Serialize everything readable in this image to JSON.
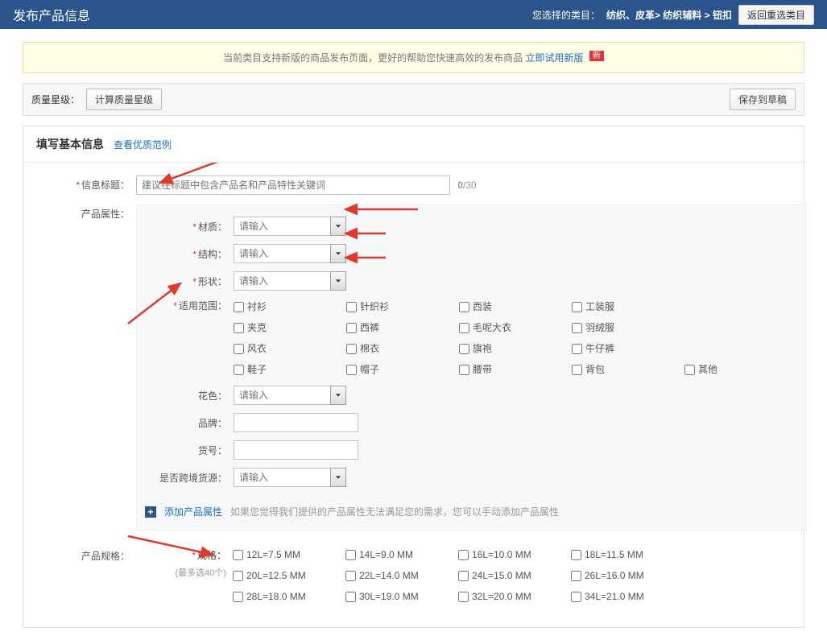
{
  "header": {
    "title": "发布产品信息",
    "category_label": "您选择的类目：",
    "category_path": "纺织、皮革> 纺织辅料 > 钮扣",
    "back_btn": "返回重选类目"
  },
  "notice": {
    "text": "当前类目支持新版的商品发布页面，更好的帮助您快速高效的发布商品",
    "link": "立即试用新版",
    "badge": "新"
  },
  "toolbar": {
    "quality_label": "质量星级：",
    "calc_btn": "计算质量星级",
    "save_btn": "保存到草稿"
  },
  "section": {
    "title": "填写基本信息",
    "example_link": "查看优质范例"
  },
  "title_field": {
    "label": "信息标题：",
    "placeholder": "建议在标题中包含产品名和产品特性关键词",
    "counter_cur": "0",
    "counter_max": "/30"
  },
  "attrs": {
    "label": "产品属性：",
    "material": "材质：",
    "structure": "结构：",
    "shape": "形状：",
    "input_ph": "请输入",
    "scope": "适用范围：",
    "scope_items": [
      "衬衫",
      "针织衫",
      "西装",
      "工装服",
      "夹克",
      "西裤",
      "毛呢大衣",
      "羽绒服",
      "风衣",
      "棉衣",
      "旗袍",
      "牛仔裤",
      "鞋子",
      "帽子",
      "腰带",
      "背包",
      "其他"
    ],
    "color": "花色：",
    "brand": "品牌：",
    "artno": "货号：",
    "cross": "是否跨境货源：",
    "add_link": "添加产品属性",
    "add_hint": "如果您觉得我们提供的产品属性无法满足您的需求，您可以手动添加产品属性"
  },
  "spec": {
    "label": "产品规格：",
    "sub_label": "规格：",
    "limit": "(最多选40个)",
    "items": [
      "12L=7.5 MM",
      "14L=9.0 MM",
      "16L=10.0 MM",
      "18L=11.5 MM",
      "20L=12.5 MM",
      "22L=14.0 MM",
      "24L=15.0 MM",
      "26L=16.0 MM",
      "28L=18.0 MM",
      "30L=19.0 MM",
      "32L=20.0 MM",
      "34L=21.0 MM"
    ]
  }
}
